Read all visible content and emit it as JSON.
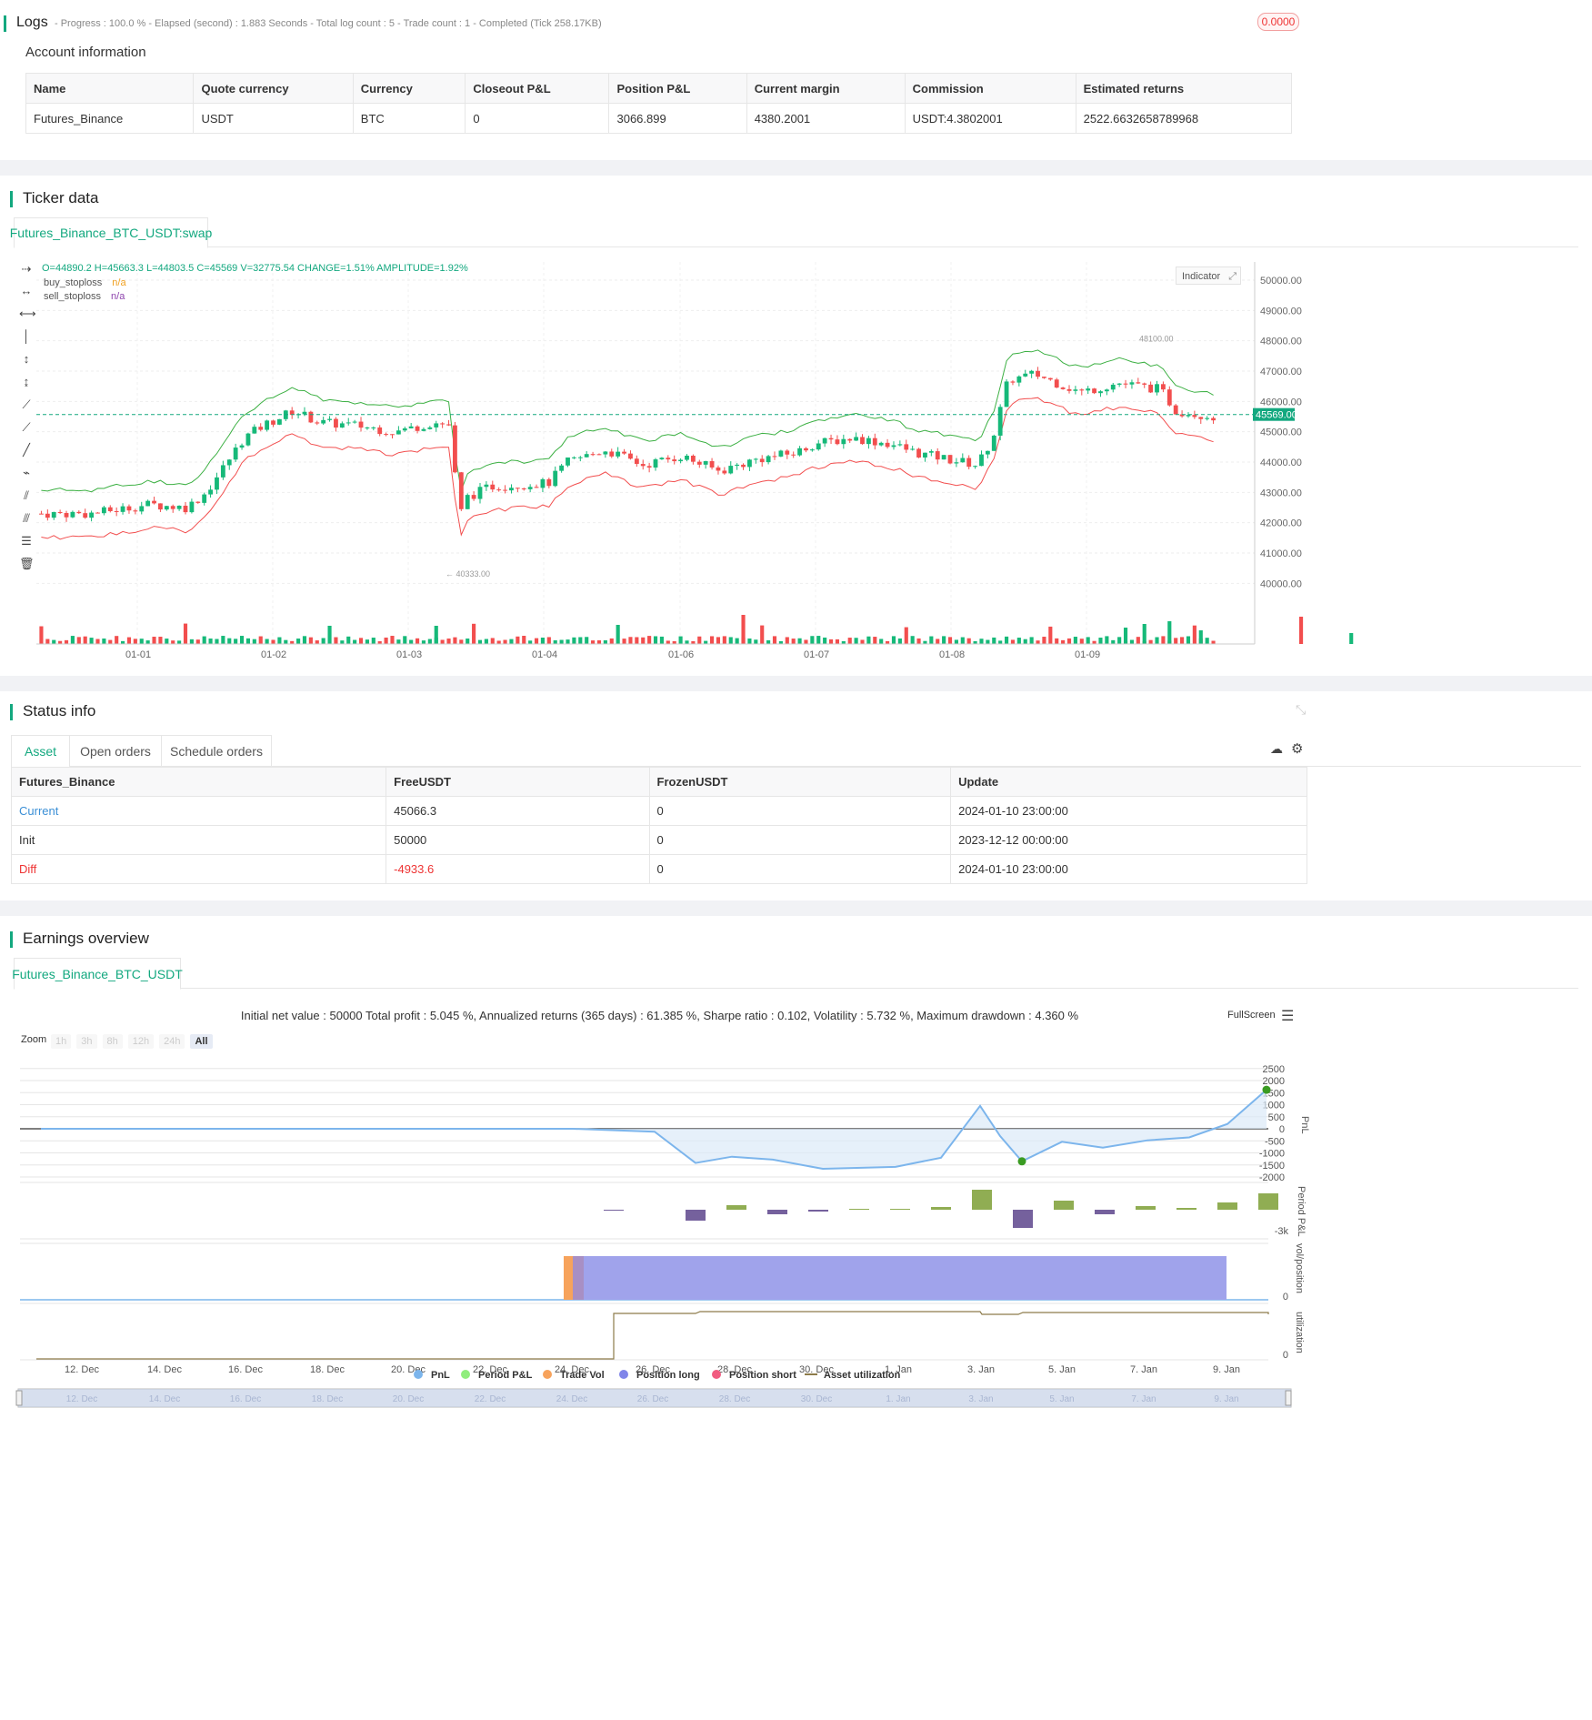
{
  "logs": {
    "title": "Logs",
    "summary": "- Progress : 100.0 % - Elapsed (second) : 1.883  Seconds - Total log count : 5 - Trade count : 1 - Completed (Tick 258.17KB)",
    "badge": "0.0000"
  },
  "account": {
    "title": "Account information",
    "headers": [
      "Name",
      "Quote currency",
      "Currency",
      "Closeout P&L",
      "Position P&L",
      "Current margin",
      "Commission",
      "Estimated returns"
    ],
    "row": [
      "Futures_Binance",
      "USDT",
      "BTC",
      "0",
      "3066.899",
      "4380.2001",
      "USDT:4.3802001",
      "2522.6632658789968"
    ]
  },
  "ticker": {
    "title": "Ticker data",
    "tab": "Futures_Binance_BTC_USDT:swap",
    "ohlc": "O=44890.2 H=45663.3 L=44803.5 C=45569 V=32775.54 CHANGE=1.51% AMPLITUDE=1.92%",
    "legend": [
      {
        "name": "buy_stoploss",
        "value": "n/a",
        "color": "#f0a020"
      },
      {
        "name": "sell_stoploss",
        "value": "n/a",
        "color": "#8e44ad"
      }
    ],
    "indicator_btn": "Indicator",
    "price_ticks": [
      "50000.00",
      "49000.00",
      "48000.00",
      "47000.00",
      "46000.00",
      "45000.00",
      "44000.00",
      "43000.00",
      "42000.00",
      "41000.00",
      "40000.00"
    ],
    "current_price": "45569.00",
    "high_label": "48100.00",
    "low_label": "40333.00",
    "date_ticks": [
      "01-01",
      "01-02",
      "01-03",
      "01-04",
      "01-06",
      "01-07",
      "01-08",
      "01-09"
    ],
    "colors": {
      "up": "#16b979",
      "down": "#f24e4e",
      "upper_band": "#3cb043",
      "lower_band": "#f24e4e"
    }
  },
  "status": {
    "title": "Status info",
    "tabs": [
      "Asset",
      "Open orders",
      "Schedule orders"
    ],
    "headers": [
      "Futures_Binance",
      "FreeUSDT",
      "FrozenUSDT",
      "Update"
    ],
    "rows": [
      [
        "Current",
        "45066.3",
        "0",
        "2024-01-10 23:00:00"
      ],
      [
        "Init",
        "50000",
        "0",
        "2023-12-12 00:00:00"
      ],
      [
        "Diff",
        "-4933.6",
        "0",
        "2024-01-10 23:00:00"
      ]
    ]
  },
  "earnings": {
    "title": "Earnings overview",
    "tab": "Futures_Binance_BTC_USDT",
    "summary": "Initial net value : 50000 Total profit : 5.045 %, Annualized returns (365 days) : 61.385 %, Sharpe ratio : 0.102, Volatility : 5.732 %, Maximum drawdown : 4.360 %",
    "fullscreen": "FullScreen",
    "zoom_label": "Zoom",
    "zoom_options": [
      "1h",
      "3h",
      "8h",
      "12h",
      "24h",
      "All"
    ],
    "pnl_ticks": [
      "2500",
      "2000",
      "1500",
      "1000",
      "500",
      "0",
      "-500",
      "-1000",
      "-1500",
      "-2000"
    ],
    "axis_labels": [
      "PnL",
      "Period P&L",
      "vol/position",
      "utilization"
    ],
    "period_tick": "-3k",
    "vol_tick": "0",
    "util_tick": "0",
    "date_ticks": [
      "12. Dec",
      "14. Dec",
      "16. Dec",
      "18. Dec",
      "20. Dec",
      "22. Dec",
      "24. Dec",
      "26. Dec",
      "28. Dec",
      "30. Dec",
      "1. Jan",
      "3. Jan",
      "5. Jan",
      "7. Jan",
      "9. Jan"
    ],
    "legend": [
      {
        "name": "PnL",
        "color": "#7cb5ec"
      },
      {
        "name": "Period P&L",
        "color": "#90ed7d"
      },
      {
        "name": "Trade Vol",
        "color": "#f7a35c"
      },
      {
        "name": "Position long",
        "color": "#8085e9"
      },
      {
        "name": "Position short",
        "color": "#f15c80"
      },
      {
        "name": "Asset utilization",
        "color": "#8d7b4a"
      }
    ]
  }
}
